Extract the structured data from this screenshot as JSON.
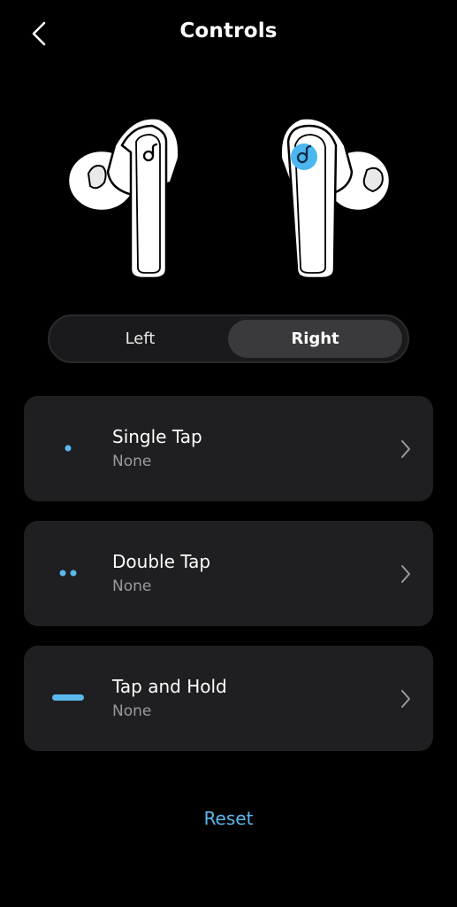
{
  "header": {
    "title": "Controls",
    "back_icon": "chevron-left-icon"
  },
  "earbuds": {
    "left_icon": "anker-logo-icon",
    "right_icon": "anker-logo-icon",
    "selected_side_color": "#4cb6f0"
  },
  "side_selector": {
    "left_label": "Left",
    "right_label": "Right",
    "selected": "Right"
  },
  "controls": [
    {
      "title": "Single Tap",
      "value": "None",
      "icon": "single-dot-icon"
    },
    {
      "title": "Double Tap",
      "value": "None",
      "icon": "double-dot-icon"
    },
    {
      "title": "Tap and Hold",
      "value": "None",
      "icon": "long-press-bar-icon"
    }
  ],
  "footer": {
    "reset_label": "Reset"
  },
  "colors": {
    "background": "#000000",
    "card": "#1f1f21",
    "accent": "#5bb8ec",
    "muted_text": "#9a9a9e"
  }
}
